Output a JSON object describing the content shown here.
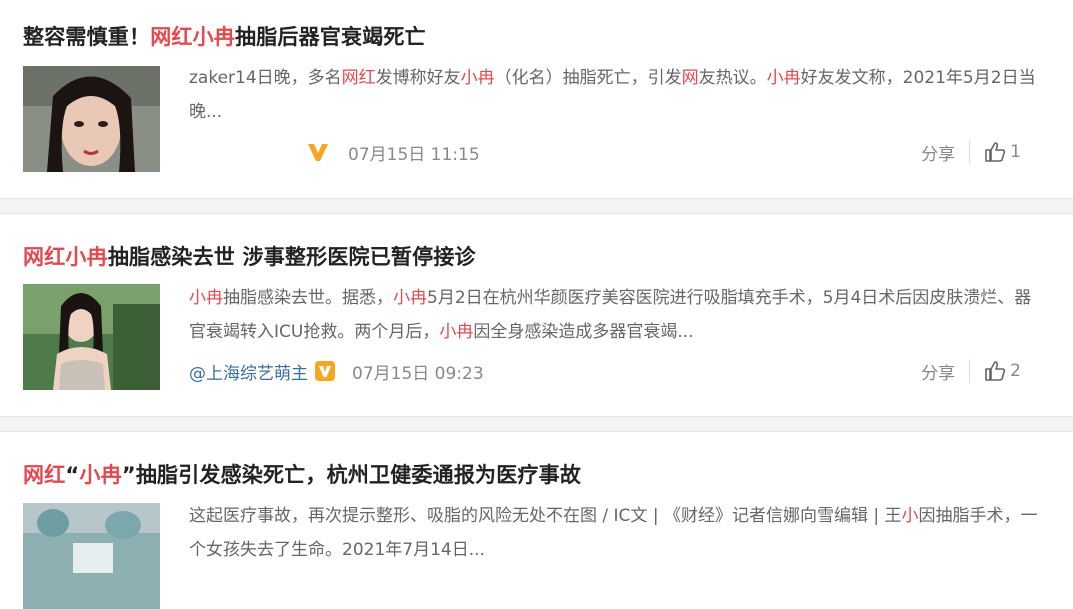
{
  "colors": {
    "highlight": "#e5484d",
    "author_link": "#3a6ea5",
    "verified": "#f5a623"
  },
  "articles": [
    {
      "title": [
        {
          "t": "整容需慎重！",
          "hl": false
        },
        {
          "t": "网红小冉",
          "hl": true
        },
        {
          "t": "抽脂后器官衰竭死亡",
          "hl": false
        }
      ],
      "summary": [
        {
          "t": "zaker14日晚，多名",
          "hl": false
        },
        {
          "t": "网红",
          "hl": true
        },
        {
          "t": "发博称好友",
          "hl": false
        },
        {
          "t": "小冉",
          "hl": true
        },
        {
          "t": "（化名）抽脂死亡，引发",
          "hl": false
        },
        {
          "t": "网",
          "hl": true
        },
        {
          "t": "友热议。",
          "hl": false
        },
        {
          "t": "小冉",
          "hl": true
        },
        {
          "t": "好友发文称，2021年5月2日当晚...",
          "hl": false
        }
      ],
      "author": "",
      "verified_icon": "vip-v-icon",
      "time": "07月15日 11:15",
      "share_label": "分享",
      "likes": "1",
      "thumb_icon": "portrait-photo"
    },
    {
      "title": [
        {
          "t": "网红小冉",
          "hl": true
        },
        {
          "t": "抽脂感染去世 涉事整形医院已暂停接诊",
          "hl": false
        }
      ],
      "summary": [
        {
          "t": "小冉",
          "hl": true
        },
        {
          "t": "抽脂感染去世。据悉，",
          "hl": false
        },
        {
          "t": "小冉",
          "hl": true
        },
        {
          "t": "5月2日在杭州华颜医疗美容医院进行吸脂填充手术，5月4日术后因皮肤溃烂、器官衰竭转入ICU抢救。两个月后，",
          "hl": false
        },
        {
          "t": "小冉",
          "hl": true
        },
        {
          "t": "因全身感染造成多器官衰竭...",
          "hl": false
        }
      ],
      "author": "@上海综艺萌主",
      "verified_icon": "verified-badge-icon",
      "time": "07月15日 09:23",
      "share_label": "分享",
      "likes": "2",
      "thumb_icon": "portrait-photo-outdoor"
    },
    {
      "title": [
        {
          "t": "网红",
          "hl": true
        },
        {
          "t": "“",
          "hl": false
        },
        {
          "t": "小冉",
          "hl": true
        },
        {
          "t": "”抽脂引发感染死亡，杭州卫健委通报为医疗事故",
          "hl": false
        }
      ],
      "summary": [
        {
          "t": "这起医疗事故，再次提示整形、吸脂的风险无处不在图 / IC文 | 《财经》记者信娜向雪编辑 | 王",
          "hl": false
        },
        {
          "t": "小",
          "hl": true
        },
        {
          "t": "因抽脂手术，一个女孩失去了生命。2021年7月14日...",
          "hl": false
        }
      ],
      "thumb_icon": "surgery-photo"
    }
  ]
}
